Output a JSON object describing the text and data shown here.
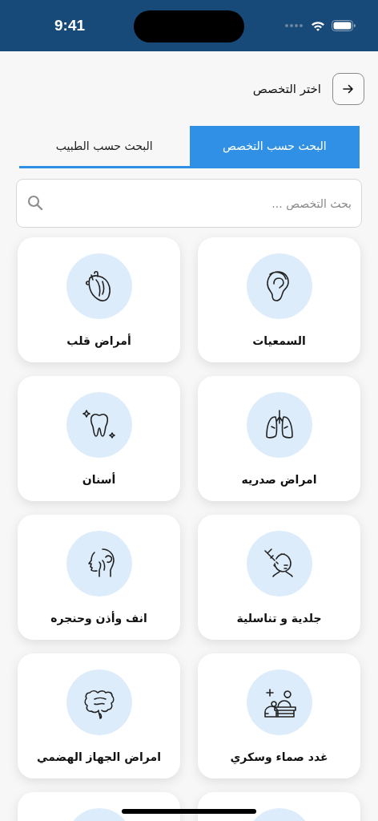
{
  "status_bar": {
    "time": "9:41"
  },
  "header": {
    "title": "اختر التخصص"
  },
  "tabs": [
    {
      "label": "البحث حسب التخصص",
      "selected": true
    },
    {
      "label": "البحث حسب الطبيب",
      "selected": false
    }
  ],
  "search": {
    "placeholder": "بحث التخصص ..."
  },
  "specialties": [
    {
      "kind": "card",
      "label": "السمعيات"
    },
    {
      "kind": "card",
      "label": "أمراض قلب"
    },
    {
      "kind": "card",
      "label": "امراض صدريه"
    },
    {
      "kind": "card",
      "label": "أسنان"
    },
    {
      "kind": "card",
      "label": "جلدية و تناسلية"
    },
    {
      "kind": "card",
      "label": "انف وأذن وحنجره"
    },
    {
      "kind": "card",
      "label": "غدد صماء وسكري"
    },
    {
      "kind": "card",
      "label": "امراض الجهاز الهضمي"
    },
    {
      "kind": "card"
    },
    {
      "kind": "card"
    }
  ]
}
